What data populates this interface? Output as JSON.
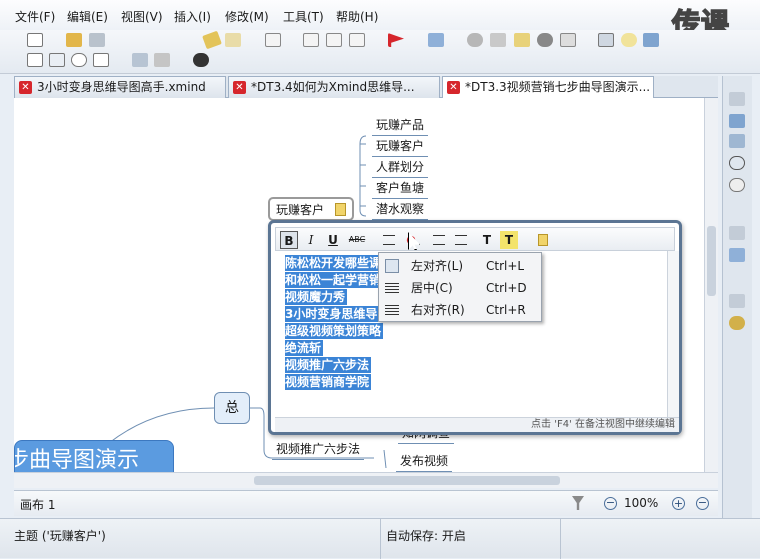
{
  "menu": [
    "文件(F)",
    "编辑(E)",
    "视图(V)",
    "插入(I)",
    "修改(M)",
    "工具(T)",
    "帮助(H)"
  ],
  "watermark": "传课",
  "tabs": [
    {
      "label": "3小时变身思维导图高手.xmind",
      "active": false
    },
    {
      "label": "*DT3.4如何为Xmind思维导...",
      "active": false
    },
    {
      "label": "*DT3.3视频营销七步曲导图演示...",
      "active": true
    }
  ],
  "mindmap": {
    "central_partial": "步曲导图演示",
    "total_node": "总",
    "selected_topic": "玩赚客户",
    "subtopics_top": [
      "玩赚产品",
      "玩赚客户",
      "人群划分",
      "客户鱼塘",
      "潜水观察"
    ],
    "subtopic_bottom_left": "视频推广六步法",
    "subtopic_bottom_partial": "知网调查",
    "subtopic_bottom_right": "发布视频"
  },
  "notes": {
    "toolbar": {
      "bold": "B",
      "italic": "I",
      "underline": "U",
      "strike": "ABC"
    },
    "lines": [
      "陈松松开发哪些课",
      "和松松一起学营销",
      "视频魔力秀",
      "3小时变身思维导图",
      "超级视频策划策略",
      "绝流斩",
      "视频推广六步法",
      "视频营销商学院"
    ],
    "hint": "点击 'F4' 在备注视图中继续编辑"
  },
  "align_menu": [
    {
      "label": "左对齐(L)",
      "shortcut": "Ctrl+L"
    },
    {
      "label": "居中(C)",
      "shortcut": "Ctrl+D"
    },
    {
      "label": "右对齐(R)",
      "shortcut": "Ctrl+R"
    }
  ],
  "sheet": {
    "tab_label": "画布 1",
    "zoom": "100%"
  },
  "status": {
    "topic": "主题 ('玩赚客户')",
    "autosave": "自动保存: 开启"
  },
  "colors": {
    "accent": "#3b84d6",
    "close_red": "#d6262c",
    "central_fill": "#5b9be0"
  }
}
